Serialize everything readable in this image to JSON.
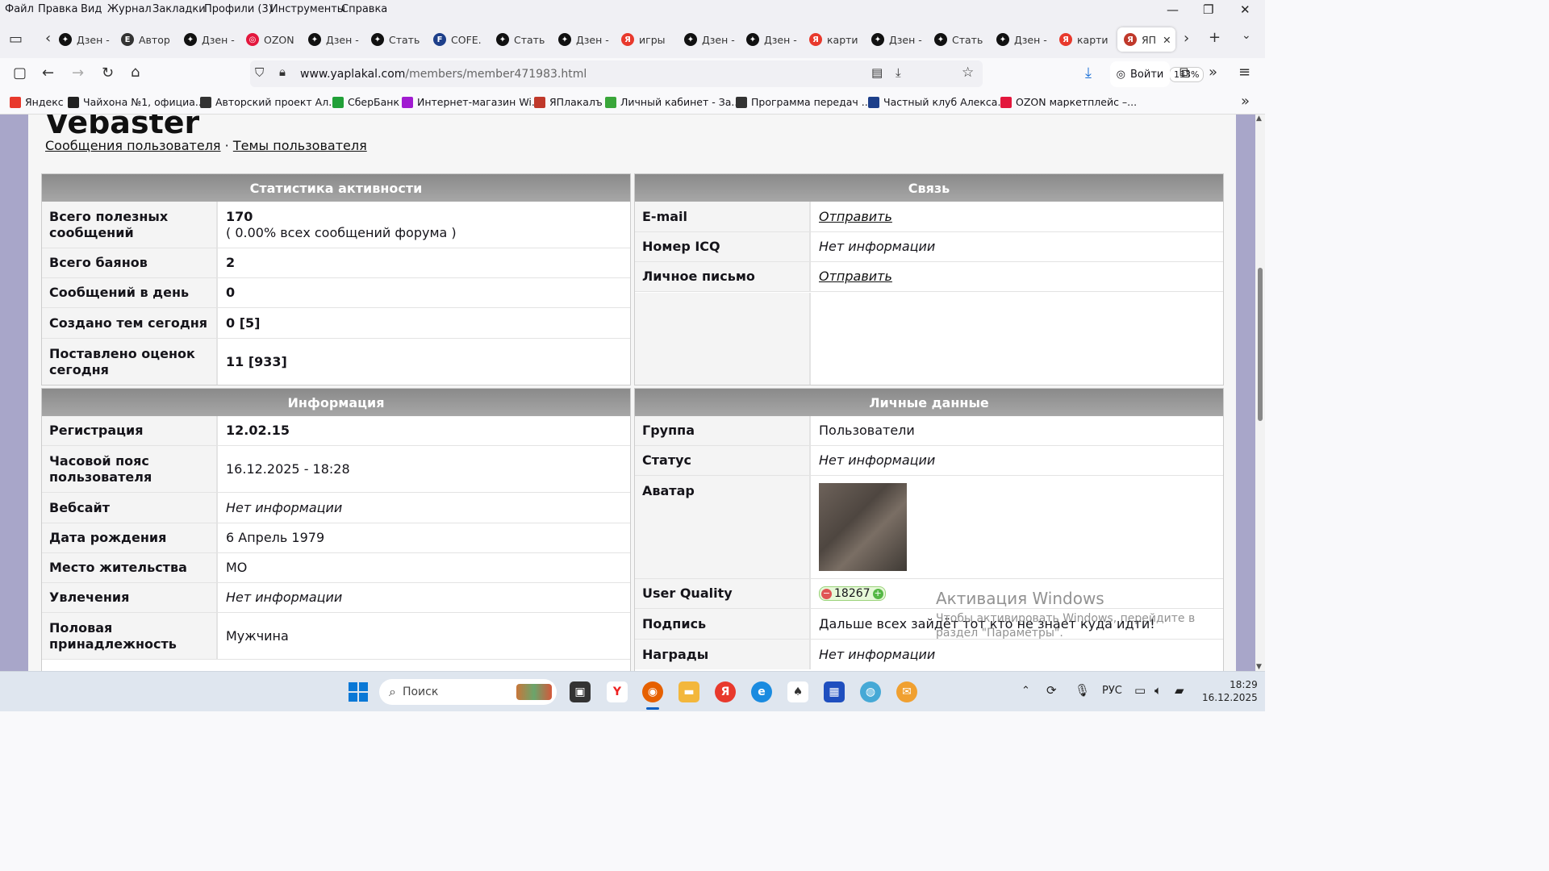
{
  "menubar": {
    "items": [
      "Файл",
      "Правка",
      "Вид",
      "Журнал",
      "Закладки",
      "Профили (3)",
      "Инструменты",
      "Справка"
    ]
  },
  "tabs": [
    {
      "label": "Дзен -",
      "icon": "zen-icon"
    },
    {
      "label": "Автор",
      "icon": "e-icon"
    },
    {
      "label": "Дзен -",
      "icon": "zen-icon"
    },
    {
      "label": "OZON",
      "icon": "ozon-icon"
    },
    {
      "label": "Дзен -",
      "icon": "zen-icon"
    },
    {
      "label": "Стать",
      "icon": "zen-icon"
    },
    {
      "label": "COFE.",
      "icon": "fer-icon"
    },
    {
      "label": "Стать",
      "icon": "zen-icon"
    },
    {
      "label": "Дзен -",
      "icon": "zen-icon"
    },
    {
      "label": "игры",
      "icon": "yandex-icon"
    },
    {
      "label": "Дзен -",
      "icon": "zen-icon"
    },
    {
      "label": "Дзен -",
      "icon": "zen-icon"
    },
    {
      "label": "карти",
      "icon": "yandex-icon"
    },
    {
      "label": "Дзен -",
      "icon": "zen-icon"
    },
    {
      "label": "Стать",
      "icon": "zen-icon"
    },
    {
      "label": "Дзен -",
      "icon": "zen-icon"
    },
    {
      "label": "карти",
      "icon": "yandex-icon"
    },
    {
      "label": "ЯП",
      "icon": "yaplakal-icon",
      "active": true
    }
  ],
  "navbar": {
    "url_host": "www.yaplakal.com",
    "url_path": "/members/member471983.html",
    "zoom": "133%",
    "login_label": "Войти"
  },
  "bookmarks": [
    {
      "label": "Яндекс",
      "color": "#e8392c"
    },
    {
      "label": "Чайхона №1, официа...",
      "color": "#222222"
    },
    {
      "label": "Авторский проект Ал...",
      "color": "#333333"
    },
    {
      "label": "СберБанк",
      "color": "#21a038"
    },
    {
      "label": "Интернет-магазин Wi...",
      "color": "#a11bd1"
    },
    {
      "label": "ЯПлакалъ",
      "color": "#c0392b"
    },
    {
      "label": "Личный кабинет - За...",
      "color": "#3aa63a"
    },
    {
      "label": "Программа передач ...",
      "color": "#333333"
    },
    {
      "label": "Частный клуб Алекса...",
      "color": "#1d3f8a"
    },
    {
      "label": "OZON маркетплейс –...",
      "color": "#e3173d"
    }
  ],
  "profile": {
    "username": "Vebaster",
    "links": {
      "posts": "Сообщения пользователя",
      "sep": "·",
      "topics": "Темы пользователя"
    }
  },
  "activity": {
    "title": "Статистика активности",
    "rows": [
      {
        "label": "Всего полезных сообщений",
        "value": "170",
        "sub": "( 0.00% всех сообщений форума )"
      },
      {
        "label": "Всего баянов",
        "value": "2"
      },
      {
        "label": "Сообщений в день",
        "value": "0"
      },
      {
        "label": "Создано тем сегодня",
        "value": "0 [5]"
      },
      {
        "label": "Поставлено оценок сегодня",
        "value": "11 [933]"
      }
    ]
  },
  "contact": {
    "title": "Связь",
    "rows": [
      {
        "label": "E-mail",
        "value": "Отправить"
      },
      {
        "label": "Номер ICQ",
        "value": "Нет информации"
      },
      {
        "label": "Личное письмо",
        "value": "Отправить"
      }
    ]
  },
  "info": {
    "title": "Информация",
    "rows": [
      {
        "label": "Регистрация",
        "value": "12.02.15"
      },
      {
        "label": "Часовой пояс пользователя",
        "value": "16.12.2025 - 18:28"
      },
      {
        "label": "Вебсайт",
        "value": "Нет информации"
      },
      {
        "label": "Дата рождения",
        "value": "6 Апрель 1979"
      },
      {
        "label": "Место жительства",
        "value": "МО"
      },
      {
        "label": "Увлечения",
        "value": "Нет информации"
      },
      {
        "label": "Половая принадлежность",
        "value": "Мужчина"
      }
    ]
  },
  "personal": {
    "title": "Личные данные",
    "rows": [
      {
        "label": "Группа",
        "value": "Пользователи"
      },
      {
        "label": "Статус",
        "value": "Нет информации"
      },
      {
        "label": "Аватар",
        "value": ""
      },
      {
        "label": "User Quality",
        "value": "18267"
      },
      {
        "label": "Подпись",
        "value": "Дальше всех зайдёт тот кто не знает куда идти!"
      },
      {
        "label": "Награды",
        "value": "Нет информации"
      }
    ]
  },
  "watermark": {
    "title": "Активация Windows",
    "text": "Чтобы активировать Windows, перейдите в раздел \"Параметры\"."
  },
  "taskbar": {
    "search_placeholder": "Поиск",
    "lang": "РУС",
    "time": "18:29",
    "date": "16.12.2025"
  }
}
